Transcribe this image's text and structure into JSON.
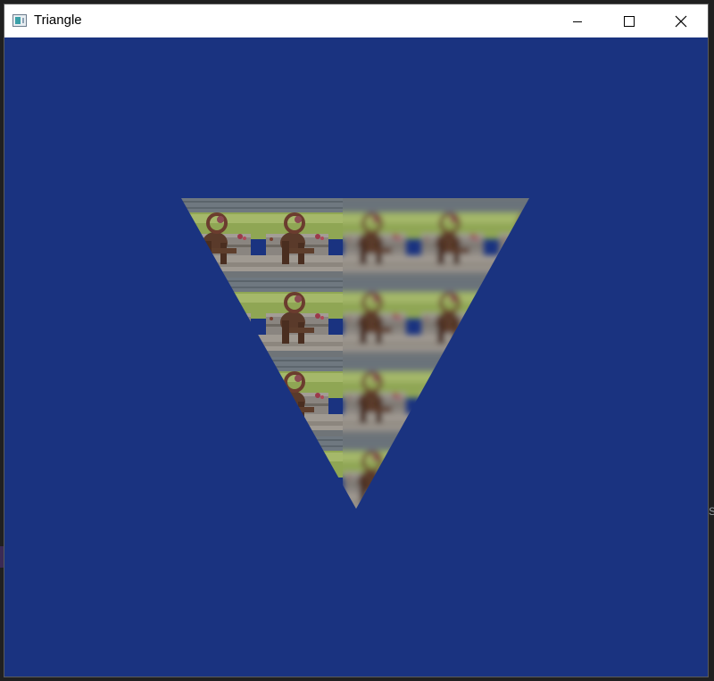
{
  "window": {
    "title": "Triangle",
    "icon": "app-window-icon"
  },
  "caption_buttons": {
    "minimize": "minimize-icon",
    "maximize": "maximize-icon",
    "close": "close-icon"
  },
  "background": {
    "edge_text": "S"
  },
  "colors": {
    "clear_color": "#1a3380",
    "titlebar": "#ffffff"
  },
  "scene": {
    "object": "textured-triangle",
    "texture": "tiled-photo-dog-sculpture",
    "left_half": "sharp-sampling",
    "right_half": "blurred-sampling"
  }
}
